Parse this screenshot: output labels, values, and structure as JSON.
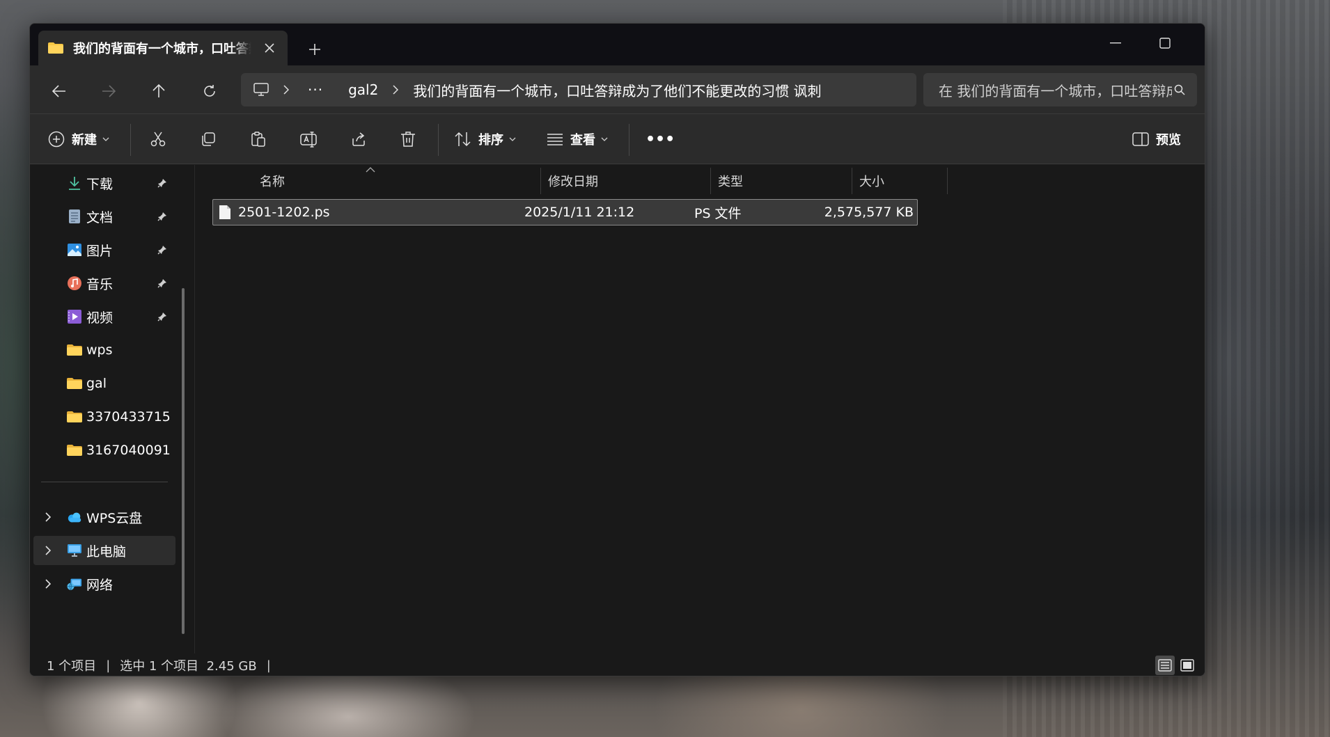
{
  "tab": {
    "title": "我们的背面有一个城市，口吐答辩成为了他们不能更改的习惯 讽刺"
  },
  "address": {
    "segments": [
      "gal2",
      "我们的背面有一个城市，口吐答辩成为了他们不能更改的习惯 讽刺"
    ],
    "ellipsis": "···"
  },
  "search": {
    "placeholder": "在 我们的背面有一个城市，口吐答辩成为了他们不能更改的习惯 讽刺 中搜索"
  },
  "toolbar": {
    "new_label": "新建",
    "sort_label": "排序",
    "view_label": "查看",
    "more_label": "•••",
    "preview_label": "预览"
  },
  "sidebar": {
    "quick": [
      {
        "label": "下载",
        "icon": "download-icon"
      },
      {
        "label": "文档",
        "icon": "document-icon"
      },
      {
        "label": "图片",
        "icon": "picture-icon"
      },
      {
        "label": "音乐",
        "icon": "music-icon"
      },
      {
        "label": "视频",
        "icon": "video-icon"
      },
      {
        "label": "wps",
        "icon": "folder-icon"
      },
      {
        "label": "gal",
        "icon": "folder-icon"
      },
      {
        "label": "3370433715",
        "icon": "folder-icon"
      },
      {
        "label": "3167040091",
        "icon": "folder-icon"
      }
    ],
    "roots": [
      {
        "label": "WPS云盘",
        "icon": "cloud-icon"
      },
      {
        "label": "此电脑",
        "icon": "computer-icon"
      },
      {
        "label": "网络",
        "icon": "network-icon"
      }
    ]
  },
  "columns": {
    "name": "名称",
    "modified": "修改日期",
    "type": "类型",
    "size": "大小"
  },
  "files": [
    {
      "name": "2501-1202.ps",
      "modified": "2025/1/11 21:12",
      "type": "PS 文件",
      "size": "2,575,577 KB"
    }
  ],
  "status": {
    "items": "1 个项目",
    "selected": "选中 1 个项目  2.45 GB"
  },
  "colors": {
    "accent": "#f7c744",
    "pin": "#cfcfcf",
    "window_bg": "#1c1c1c"
  }
}
